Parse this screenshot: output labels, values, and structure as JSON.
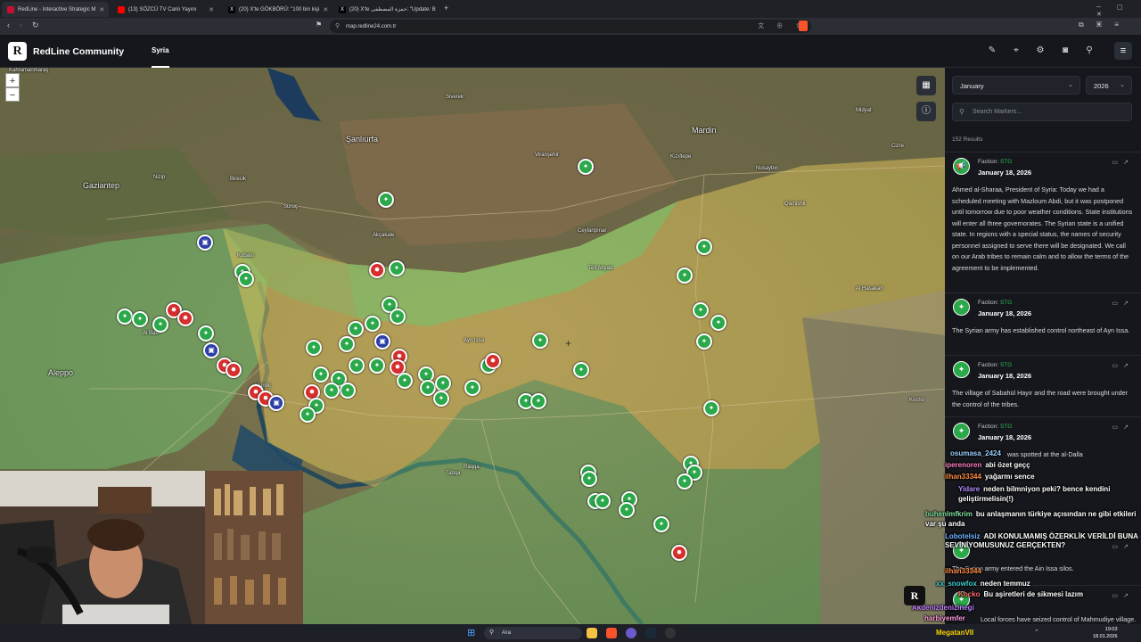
{
  "browser": {
    "tabs": [
      {
        "title": "RedLine - Interactive Strategic M",
        "active": true,
        "fav_color": "#c8102e"
      },
      {
        "title": "(13) SÖZCÜ TV Canlı Yayını",
        "active": false,
        "fav_color": "#ff0000"
      },
      {
        "title": "(20) X'te GÖKBÖRÜ: \"100 bin kişi",
        "active": false,
        "fav_color": "#111111"
      },
      {
        "title": "(20) X'te حمزة المصطفى: \"Update: B",
        "active": false,
        "fav_color": "#111111"
      }
    ],
    "new_tab": "+",
    "url": "map.redline24.com.tr"
  },
  "header": {
    "logo_letter": "R",
    "brand": "RedLine Community",
    "active_tab": "Syria",
    "icons": [
      "draw-icon",
      "location-pin-icon",
      "gear-icon",
      "camera-icon",
      "search-icon"
    ],
    "menu_icon": "≡"
  },
  "map": {
    "zoom_in": "+",
    "zoom_out": "−",
    "labels": [
      {
        "text": "Gaziantep",
        "big": true
      },
      {
        "text": "Şanlıurfa",
        "big": true
      },
      {
        "text": "Mardin",
        "big": true
      },
      {
        "text": "Aleppo",
        "big": true
      },
      {
        "text": "Kahramanmaraş"
      },
      {
        "text": "Nizip"
      },
      {
        "text": "Birecik"
      },
      {
        "text": "Suruç"
      },
      {
        "text": "Akçakale"
      },
      {
        "text": "Ceylanpınar"
      },
      {
        "text": "Kızıltepe"
      },
      {
        "text": "Nusaybin"
      },
      {
        "text": "Kobani"
      },
      {
        "text": "Al Hasakah"
      },
      {
        "text": "Raqqa"
      },
      {
        "text": "Al Bab"
      },
      {
        "text": "Manbij"
      },
      {
        "text": "Tabqa"
      },
      {
        "text": "Ayn Issa"
      },
      {
        "text": "Tell Abyad"
      },
      {
        "text": "Qamishli"
      },
      {
        "text": "Kocho"
      },
      {
        "text": "Viranşehir"
      },
      {
        "text": "Siverek"
      },
      {
        "text": "Midyat"
      },
      {
        "text": "Cizre"
      }
    ]
  },
  "sidebar": {
    "month": "January",
    "year": "2026",
    "search_placeholder": "Search Markers...",
    "results": "152 Results",
    "entries": [
      {
        "faction_label": "Faction:",
        "faction": "STG",
        "date": "January 18, 2026",
        "text": "Ahmed al-Sharaa, President of Syria: Today we had a scheduled meeting with Mazloum Abdi, but it was postponed until tomorrow due to poor weather conditions. State institutions will enter all three governorates. The Syrian state is a unified state. In regions with a special status, the names of security personnel assigned to serve there will be designated. We call on our Arab tribes to remain calm and to allow the terms of the agreement to be implemented."
      },
      {
        "faction_label": "Faction:",
        "faction": "STG",
        "date": "January 18, 2026",
        "text": "The Syrian army has established control northeast of Ayn Issa."
      },
      {
        "faction_label": "Faction:",
        "faction": "STG",
        "date": "January 18, 2026",
        "text": "The village of Sabahül Hayır and the road were brought under the control of the tribes."
      },
      {
        "faction_label": "Faction:",
        "faction": "STG",
        "date": "January 18, 2026",
        "text": "was spotted at the al-Dalla"
      },
      {
        "faction_label": "Faction:",
        "faction": "STG",
        "date": "January 18, 2026",
        "text": "The Syrian army entered the Ain Issa silos."
      },
      {
        "faction_label": "Faction:",
        "faction": "STG",
        "date": "January 18, 2026",
        "text": "Local forces have seized control of Mahmudiye village."
      }
    ]
  },
  "chat": [
    {
      "user": "osumasa_2424",
      "msg": "",
      "color": "#9ad0ff"
    },
    {
      "user": "iperenoren",
      "msg": "abi özet geçç",
      "color": "#ff7fbf"
    },
    {
      "user": "ilhan33344",
      "msg": "yağarmı sence",
      "color": "#ff8c42"
    },
    {
      "user": "Yidare",
      "msg": "neden bilmniyon peki? bence kendini geliştirmelisin(!)",
      "color": "#b38cff"
    },
    {
      "user": "buhenlmfkrim",
      "msg": "bu anlaşmanın türkiye açısından ne gibi etkileri var şu anda",
      "color": "#7fe0a0"
    },
    {
      "user": "Lobotelsiz",
      "msg": "ADI KONULMAMIŞ ÖZERKLİK VERİLDİ BUNA SEVİNİYOMUSUNUZ GERÇEKTEN?",
      "color": "#6fb3ff"
    },
    {
      "user": "ilhan33344",
      "msg": "",
      "color": "#ff8c42"
    },
    {
      "user": "xx_snowfox",
      "msg": "neden temmuz",
      "color": "#3fd0d0"
    },
    {
      "user": "Kocko",
      "msg": "Bu aşiretleri de sikmesi lazım",
      "color": "#ff6b6b"
    },
    {
      "user": "Akdenizdenizinegi",
      "msg": "",
      "color": "#c080ff"
    },
    {
      "user": "harbiyemfer",
      "msg": "",
      "color": "#ff9de0"
    }
  ],
  "streamer": "MegatanVII",
  "taskbar": {
    "search": "Ara",
    "time": "19:03",
    "date": "18.01.2026"
  },
  "colors": {
    "syrian_gov": "#e0c35a",
    "sdf": "#6fc46f",
    "marker_green": "#2aa84a",
    "marker_red": "#d62d2d",
    "marker_blue": "#2b3fa6"
  }
}
